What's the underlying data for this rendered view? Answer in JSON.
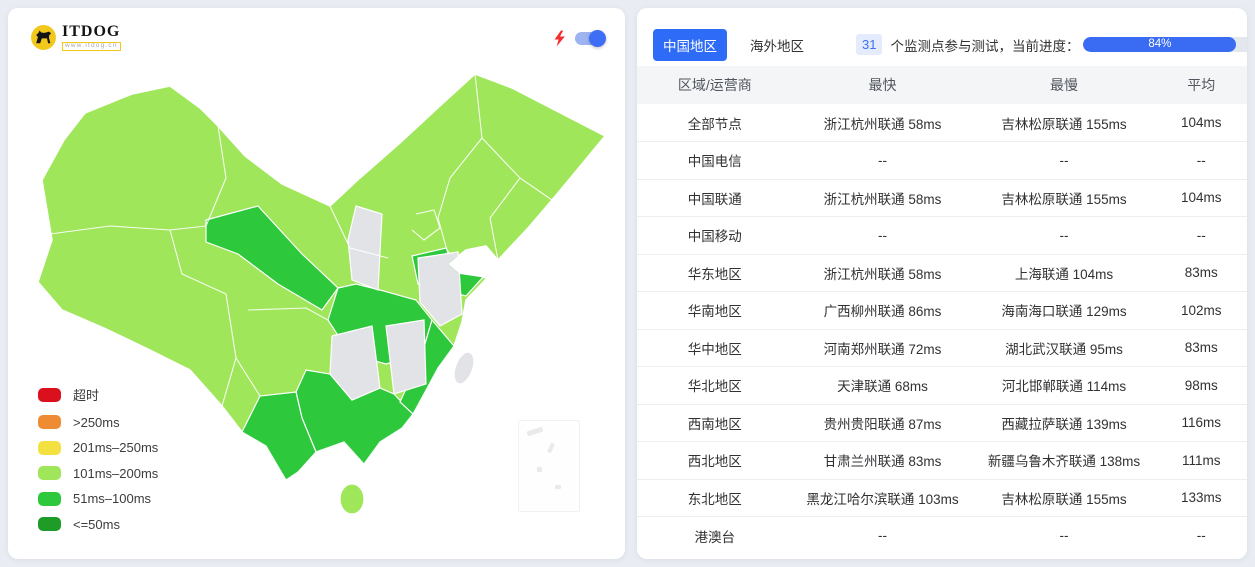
{
  "logo": {
    "title": "ITDOG",
    "subtitle": "www.itdog.cn"
  },
  "map": {
    "colors": {
      "light_green": "#a0e65a",
      "mid_green": "#2dc83c",
      "no_data_gray": "#e2e3e6",
      "border_white": "#ffffff"
    },
    "legend": [
      {
        "label": "超时",
        "color": "#da101d"
      },
      {
        "label": ">250ms",
        "color": "#ef8b33"
      },
      {
        "label": "201ms–250ms",
        "color": "#f3e141"
      },
      {
        "label": "101ms–200ms",
        "color": "#a0e65a"
      },
      {
        "label": "51ms–100ms",
        "color": "#2dc83c"
      },
      {
        "label": "<=50ms",
        "color": "#1e9c27"
      }
    ]
  },
  "results": {
    "tabs": [
      {
        "label": "中国地区",
        "active": true
      },
      {
        "label": "海外地区",
        "active": false
      }
    ],
    "monitor_count": "31",
    "status_text": "个监测点参与测试，当前进度：",
    "progress_value": 84,
    "progress_label": "84%",
    "accent_color": "#2e6bf6",
    "table": {
      "columns": [
        "区域/运营商",
        "最快",
        "最慢",
        "平均"
      ],
      "rows": [
        [
          "全部节点",
          "浙江杭州联通 58ms",
          "吉林松原联通 155ms",
          "104ms"
        ],
        [
          "中国电信",
          "--",
          "--",
          "--"
        ],
        [
          "中国联通",
          "浙江杭州联通 58ms",
          "吉林松原联通 155ms",
          "104ms"
        ],
        [
          "中国移动",
          "--",
          "--",
          "--"
        ],
        [
          "华东地区",
          "浙江杭州联通 58ms",
          "上海联通 104ms",
          "83ms"
        ],
        [
          "华南地区",
          "广西柳州联通 86ms",
          "海南海口联通 129ms",
          "102ms"
        ],
        [
          "华中地区",
          "河南郑州联通 72ms",
          "湖北武汉联通 95ms",
          "83ms"
        ],
        [
          "华北地区",
          "天津联通 68ms",
          "河北邯郸联通 114ms",
          "98ms"
        ],
        [
          "西南地区",
          "贵州贵阳联通 87ms",
          "西藏拉萨联通 139ms",
          "116ms"
        ],
        [
          "西北地区",
          "甘肃兰州联通 83ms",
          "新疆乌鲁木齐联通 138ms",
          "111ms"
        ],
        [
          "东北地区",
          "黑龙江哈尔滨联通 103ms",
          "吉林松原联通 155ms",
          "133ms"
        ],
        [
          "港澳台",
          "--",
          "--",
          "--"
        ]
      ]
    }
  }
}
